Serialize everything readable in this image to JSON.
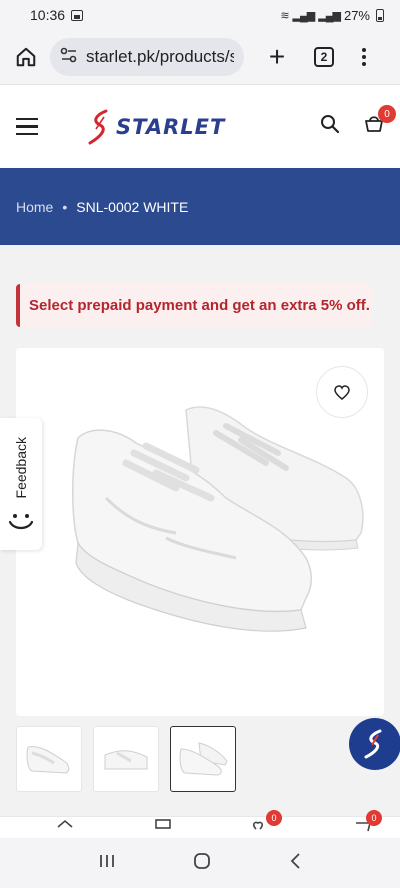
{
  "status_bar": {
    "time": "10:36",
    "battery": "27%"
  },
  "browser": {
    "url": "starlet.pk/products/s",
    "tab_count": "2"
  },
  "site": {
    "logo_text": "STARLET",
    "cart_count": "0"
  },
  "breadcrumb": {
    "home": "Home",
    "separator": "•",
    "current": "SNL-0002 WHITE"
  },
  "promo": {
    "text": "Select prepaid payment and get an extra 5% off."
  },
  "feedback": {
    "label": "Feedback"
  },
  "bottom_nav": {
    "wishlist_count": "0",
    "cart_count": "0"
  },
  "colors": {
    "brand_blue": "#2b4a8f",
    "promo_red": "#b3262d",
    "badge_red": "#e03a32"
  },
  "icons": [
    "home-icon",
    "site-settings-icon",
    "plus-icon",
    "tabs-icon",
    "more-vert-icon",
    "hamburger-icon",
    "search-icon",
    "cart-icon",
    "heart-icon",
    "smile-icon",
    "chat-logo-icon"
  ]
}
